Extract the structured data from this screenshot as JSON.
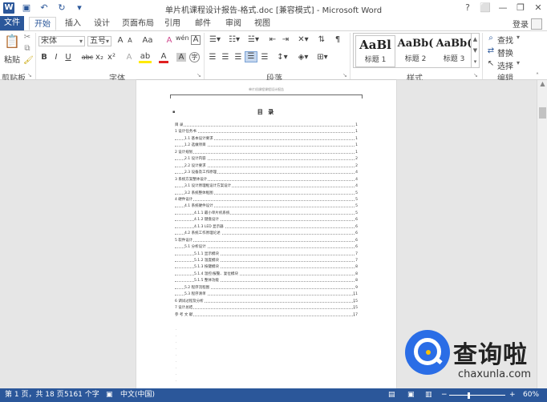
{
  "window": {
    "title": "单片机课程设计报告-格式.doc [兼容模式] - Microsoft Word",
    "controls": [
      "?",
      "⬜",
      "—",
      "❐",
      "✕"
    ]
  },
  "qat": {
    "word_icon": "W",
    "save_icon": "save-icon",
    "undo_icon": "undo-icon",
    "redo_icon": "redo-icon"
  },
  "tabs": [
    "文件",
    "开始",
    "插入",
    "设计",
    "页面布局",
    "引用",
    "邮件",
    "审阅",
    "视图"
  ],
  "login": "登录",
  "ribbon": {
    "clipboard": {
      "paste": "粘贴",
      "label": "剪贴板"
    },
    "font": {
      "name": "宋体",
      "size": "五号",
      "grow": "A",
      "shrink": "A",
      "case": "Aa",
      "clear": "A",
      "phonetic": "wén",
      "border_char": "A",
      "bold": "B",
      "italic": "I",
      "underline": "U",
      "strike": "abc",
      "subscript": "x₂",
      "superscript": "x²",
      "effects": "A",
      "highlight": "ab",
      "color": "A",
      "shade": "A",
      "circle": "字",
      "label": "字体"
    },
    "paragraph": {
      "label": "段落"
    },
    "styles": {
      "items": [
        {
          "preview": "AaBl",
          "name": "标题 1"
        },
        {
          "preview": "AaBb(",
          "name": "标题 2"
        },
        {
          "preview": "AaBb(",
          "name": "标题 3"
        }
      ],
      "label": "样式"
    },
    "editing": {
      "find": "查找",
      "replace": "替换",
      "select": "选择",
      "label": "编辑"
    }
  },
  "document": {
    "header": "单片机课程课程设计报告",
    "toc_title": "目 录",
    "toc": [
      {
        "text": "目 录",
        "page": "1",
        "indent": 0
      },
      {
        "text": "1 设计任务书",
        "page": "1",
        "indent": 0
      },
      {
        "text": "1.1 基本设计要求",
        "page": "1",
        "indent": 1
      },
      {
        "text": "1.2 选做项目",
        "page": "1",
        "indent": 1
      },
      {
        "text": "2 设计规划",
        "page": "1",
        "indent": 0
      },
      {
        "text": "2.1 设计内容",
        "page": "2",
        "indent": 1
      },
      {
        "text": "2.2 设计要求",
        "page": "2",
        "indent": 1
      },
      {
        "text": "2.3 设备及工作原理",
        "page": "4",
        "indent": 1
      },
      {
        "text": "3 系统方案整体设计",
        "page": "4",
        "indent": 0
      },
      {
        "text": "3.1 设计原理框设计方案设计",
        "page": "4",
        "indent": 1
      },
      {
        "text": "3.2 系统整体框图",
        "page": "5",
        "indent": 1
      },
      {
        "text": "4 硬件设计",
        "page": "5",
        "indent": 0
      },
      {
        "text": "4.1 系统硬件设计",
        "page": "5",
        "indent": 1
      },
      {
        "text": "4.1.1 最小单片机系统",
        "page": "5",
        "indent": 2
      },
      {
        "text": "4.1.2 键盘设计",
        "page": "6",
        "indent": 2
      },
      {
        "text": "4.1.3 LED 显示器",
        "page": "6",
        "indent": 2
      },
      {
        "text": "4.2 系统工作原理论述",
        "page": "6",
        "indent": 1
      },
      {
        "text": "5 软件设计",
        "page": "6",
        "indent": 0
      },
      {
        "text": "5.1 分析设计",
        "page": "6",
        "indent": 1
      },
      {
        "text": "5.1.1 显示模块",
        "page": "7",
        "indent": 2
      },
      {
        "text": "5.1.2 温度模块",
        "page": "7",
        "indent": 2
      },
      {
        "text": "5.1.3 按键模块",
        "page": "8",
        "indent": 2
      },
      {
        "text": "5.1.4 温控/报警、复位模块",
        "page": "8",
        "indent": 2
      },
      {
        "text": "5.1.5 整体功能",
        "page": "8",
        "indent": 2
      },
      {
        "text": "5.2 程序流程图",
        "page": "9",
        "indent": 1
      },
      {
        "text": "5.3 程序清单",
        "page": "11",
        "indent": 1
      },
      {
        "text": "6 调试过程及分析",
        "page": "15",
        "indent": 0
      },
      {
        "text": "7 设计总结",
        "page": "15",
        "indent": 0
      },
      {
        "text": "参 考 文 献",
        "page": "17",
        "indent": 0
      }
    ]
  },
  "status": {
    "page": "第 1 页，共 18 页",
    "words": "5161 个字",
    "lang": "中文(中国)",
    "zoom": "60%"
  },
  "watermark": {
    "brand": "查询啦",
    "url": "chaxunla.com"
  },
  "colors": {
    "accent": "#2b579a",
    "watermark_blue": "#2a6de6",
    "watermark_yellow": "#fbc200"
  }
}
